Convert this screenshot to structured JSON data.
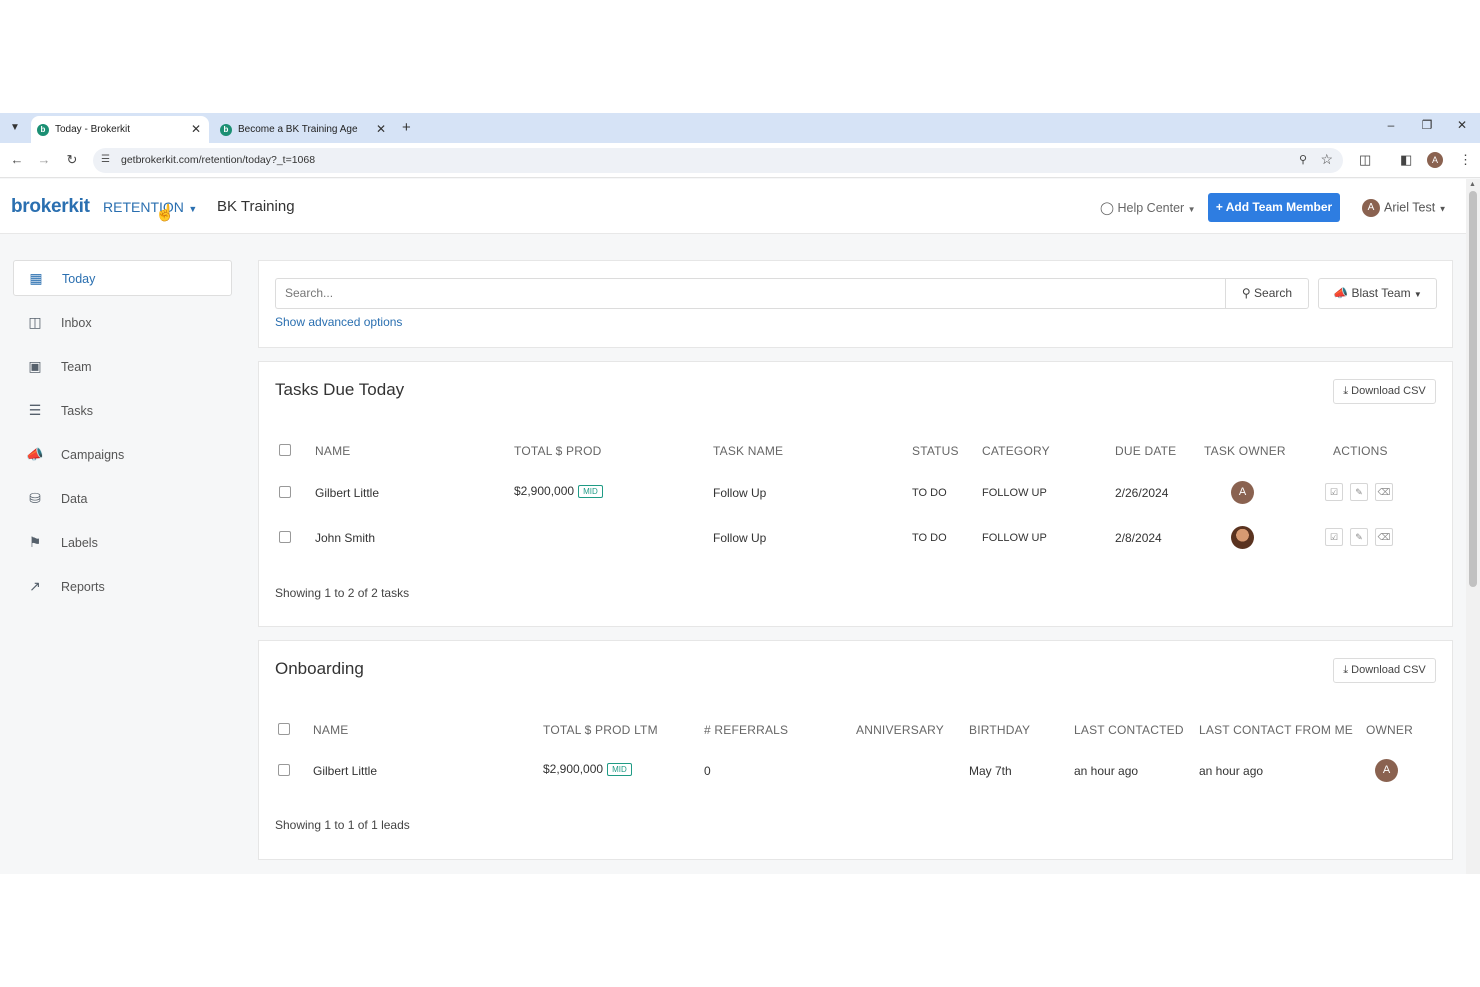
{
  "browser": {
    "tabs": [
      {
        "title": "Today - Brokerkit",
        "favicon": "b"
      },
      {
        "title": "Become a BK Training Agent!",
        "favicon": "b"
      }
    ],
    "url": "getbrokerkit.com/retention/today?_t=1068"
  },
  "header": {
    "logo": "brokerkit",
    "module": "RETENTION",
    "org": "BK Training",
    "help": "Help Center",
    "add_button": "+ Add Team Member",
    "user": "Ariel Test",
    "user_initial": "A"
  },
  "sidebar": {
    "items": [
      {
        "label": "Today",
        "icon": "calendar-icon"
      },
      {
        "label": "Inbox",
        "icon": "inbox-icon"
      },
      {
        "label": "Team",
        "icon": "contact-card-icon"
      },
      {
        "label": "Tasks",
        "icon": "tasks-list-icon"
      },
      {
        "label": "Campaigns",
        "icon": "megaphone-icon"
      },
      {
        "label": "Data",
        "icon": "database-icon"
      },
      {
        "label": "Labels",
        "icon": "tags-icon"
      },
      {
        "label": "Reports",
        "icon": "line-chart-icon"
      }
    ]
  },
  "search": {
    "placeholder": "Search...",
    "button": "Search",
    "blast": "Blast Team",
    "advanced": "Show advanced options"
  },
  "tasks": {
    "title": "Tasks Due Today",
    "csv": "Download CSV",
    "columns": [
      "NAME",
      "TOTAL $ PROD",
      "TASK NAME",
      "STATUS",
      "CATEGORY",
      "DUE DATE",
      "TASK OWNER",
      "ACTIONS"
    ],
    "rows": [
      {
        "name": "Gilbert Little",
        "prod": "$2,900,000",
        "badge": "MID",
        "task": "Follow Up",
        "status": "TO DO",
        "category": "FOLLOW UP",
        "due": "2/26/2024",
        "owner": "A"
      },
      {
        "name": "John Smith",
        "prod": "",
        "badge": "",
        "task": "Follow Up",
        "status": "TO DO",
        "category": "FOLLOW UP",
        "due": "2/8/2024",
        "owner": ""
      }
    ],
    "footer": "Showing 1 to 2 of 2 tasks"
  },
  "onboarding": {
    "title": "Onboarding",
    "csv": "Download CSV",
    "columns": [
      "NAME",
      "TOTAL $ PROD LTM",
      "# REFERRALS",
      "ANNIVERSARY",
      "BIRTHDAY",
      "LAST CONTACTED",
      "LAST CONTACT FROM ME",
      "OWNER"
    ],
    "rows": [
      {
        "name": "Gilbert Little",
        "prod": "$2,900,000",
        "badge": "MID",
        "referrals": "0",
        "anniversary": "",
        "birthday": "May 7th",
        "last_contacted": "an hour ago",
        "last_from_me": "an hour ago",
        "owner": "A"
      }
    ],
    "footer": "Showing 1 to 1 of 1 leads"
  },
  "colors": {
    "accent": "#2a6fb0",
    "button": "#2e7de1",
    "badge": "#1f9b85"
  }
}
